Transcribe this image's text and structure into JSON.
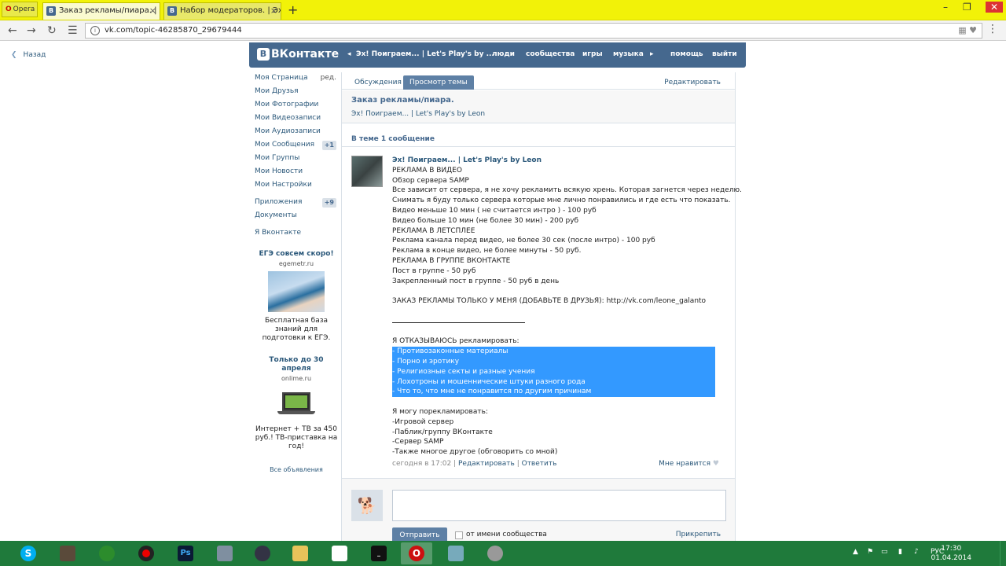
{
  "browser": {
    "menu_label": "Opera",
    "tabs": [
      {
        "label": "Заказ рекламы/пиара. | Э",
        "active": true
      },
      {
        "label": "Набор модераторов. | Эх",
        "active": false
      }
    ],
    "url": "vk.com/topic-46285870_29679444"
  },
  "page": {
    "back_label": "Назад",
    "header": {
      "logo": "ВКонтакте",
      "group_link": "Эх! Поиграем... | Let's Play's by ...",
      "nav": [
        "люди",
        "сообщества",
        "игры",
        "музыка",
        "помощь",
        "выйти"
      ]
    },
    "left_menu": [
      {
        "label": "Моя Страница",
        "extra": "ред."
      },
      {
        "label": "Мои Друзья"
      },
      {
        "label": "Мои Фотографии"
      },
      {
        "label": "Мои Видеозаписи"
      },
      {
        "label": "Мои Аудиозаписи"
      },
      {
        "label": "Мои Сообщения",
        "count": "+1"
      },
      {
        "label": "Мои Группы"
      },
      {
        "label": "Мои Новости"
      },
      {
        "label": "Мои Настройки"
      },
      {
        "label": "Приложения",
        "count": "+9"
      },
      {
        "label": "Документы"
      },
      {
        "label": "Я Вконтакте"
      }
    ],
    "ads": [
      {
        "title": "ЕГЭ совсем скоро!",
        "domain": "egemetr.ru",
        "text": "Бесплатная база знаний для подготовки к ЕГЭ."
      },
      {
        "title": "Только до 30 апреля",
        "domain": "onlime.ru",
        "text": "Интернет + ТВ за 450 руб.! ТВ-приставка на год!"
      }
    ],
    "all_ads": "Все объявления",
    "tabs": {
      "discussions": "Обсуждения",
      "view_topic": "Просмотр темы",
      "edit": "Редактировать"
    },
    "topic": {
      "title": "Заказ рекламы/пиара.",
      "group": "Эх! Поиграем... | Let's Play's by Leon",
      "count_text": "В теме 1 сообщение"
    },
    "post": {
      "author": "Эх! Поиграем... | Let's Play's by Leon",
      "lines_a": [
        "РЕКЛАМА В ВИДЕО",
        "Обзор сервера SAMP",
        "Все зависит от сервера, я не хочу рекламить всякую хрень. Которая загнется через неделю.",
        "Снимать я буду только сервера которые мне лично понравились и где есть что показать.",
        "Видео меньше 10 мин ( не считается интро ) - 100 руб",
        "Видео больше 10 мин (не более 30 мин) - 200 руб",
        "РЕКЛАМА В ЛЕТСПЛЕЕ",
        "Реклама канала перед видео, не более 30 сек (после интро) - 100 руб",
        "Реклама в конце видео, не более минуты - 50 руб.",
        "РЕКЛАМА В ГРУППЕ ВКОНТАКТЕ",
        "Пост в группе - 50 руб",
        "Закрепленный пост в группе - 50 руб в день"
      ],
      "order_line": "ЗАКАЗ РЕКЛАМЫ ТОЛЬКО У МЕНЯ (ДОБАВЬТЕ В ДРУЗЬЯ): http://vk.com/leone_galanto",
      "refuse_header": "Я ОТКАЗЫВАЮСЬ рекламировать:",
      "refuse_items": [
        "- Противозаконные материалы",
        "- Порно и эротику",
        "- Религиозные секты и разные учения",
        "- Лохотроны и мошеннические штуки разного рода",
        "- Что то, что мне не понравится по другим причинам"
      ],
      "can_header": "Я могу порекламировать:",
      "can_items": [
        "-Игровой сервер",
        "-Паблик/группу ВКонтакте",
        "-Сервер SAMP",
        "-Также многое другое (обговорить со мной)"
      ],
      "meta": {
        "time": "сегодня в 17:02",
        "edit": "Редактировать",
        "reply": "Ответить",
        "like": "Мне нравится"
      }
    },
    "reply": {
      "send": "Отправить",
      "as_community": "от имени сообщества",
      "attach": "Прикрепить"
    }
  },
  "taskbar": {
    "lang": "РУС",
    "time": "17:30",
    "date": "01.04.2014"
  }
}
